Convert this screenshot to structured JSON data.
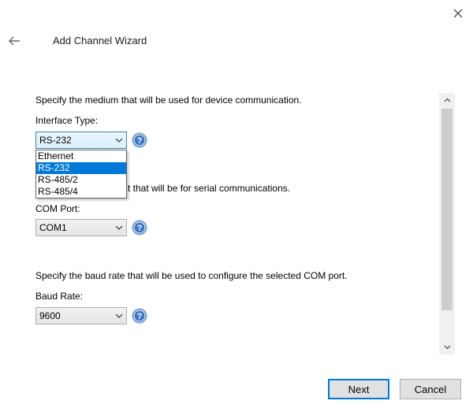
{
  "header": {
    "title": "Add Channel Wizard",
    "back_icon": "arrow-left-icon",
    "close_icon": "close-icon"
  },
  "interface": {
    "description": "Specify the medium that will be used for device communication.",
    "label": "Interface Type:",
    "selected": "RS-232",
    "options": [
      "Ethernet",
      "RS-232",
      "RS-485/2",
      "RS-485/4"
    ],
    "selected_index": 1
  },
  "com_port": {
    "description_visible": "t that will be for serial communications.",
    "label": "COM Port:",
    "selected": "COM1"
  },
  "baud": {
    "description": "Specify the baud rate that will be used to configure the selected COM port.",
    "label": "Baud Rate:",
    "selected": "9600"
  },
  "footer": {
    "next_label": "Next",
    "cancel_label": "Cancel"
  },
  "colors": {
    "accent": "#0078d7",
    "help_blue": "#3a78c4"
  }
}
